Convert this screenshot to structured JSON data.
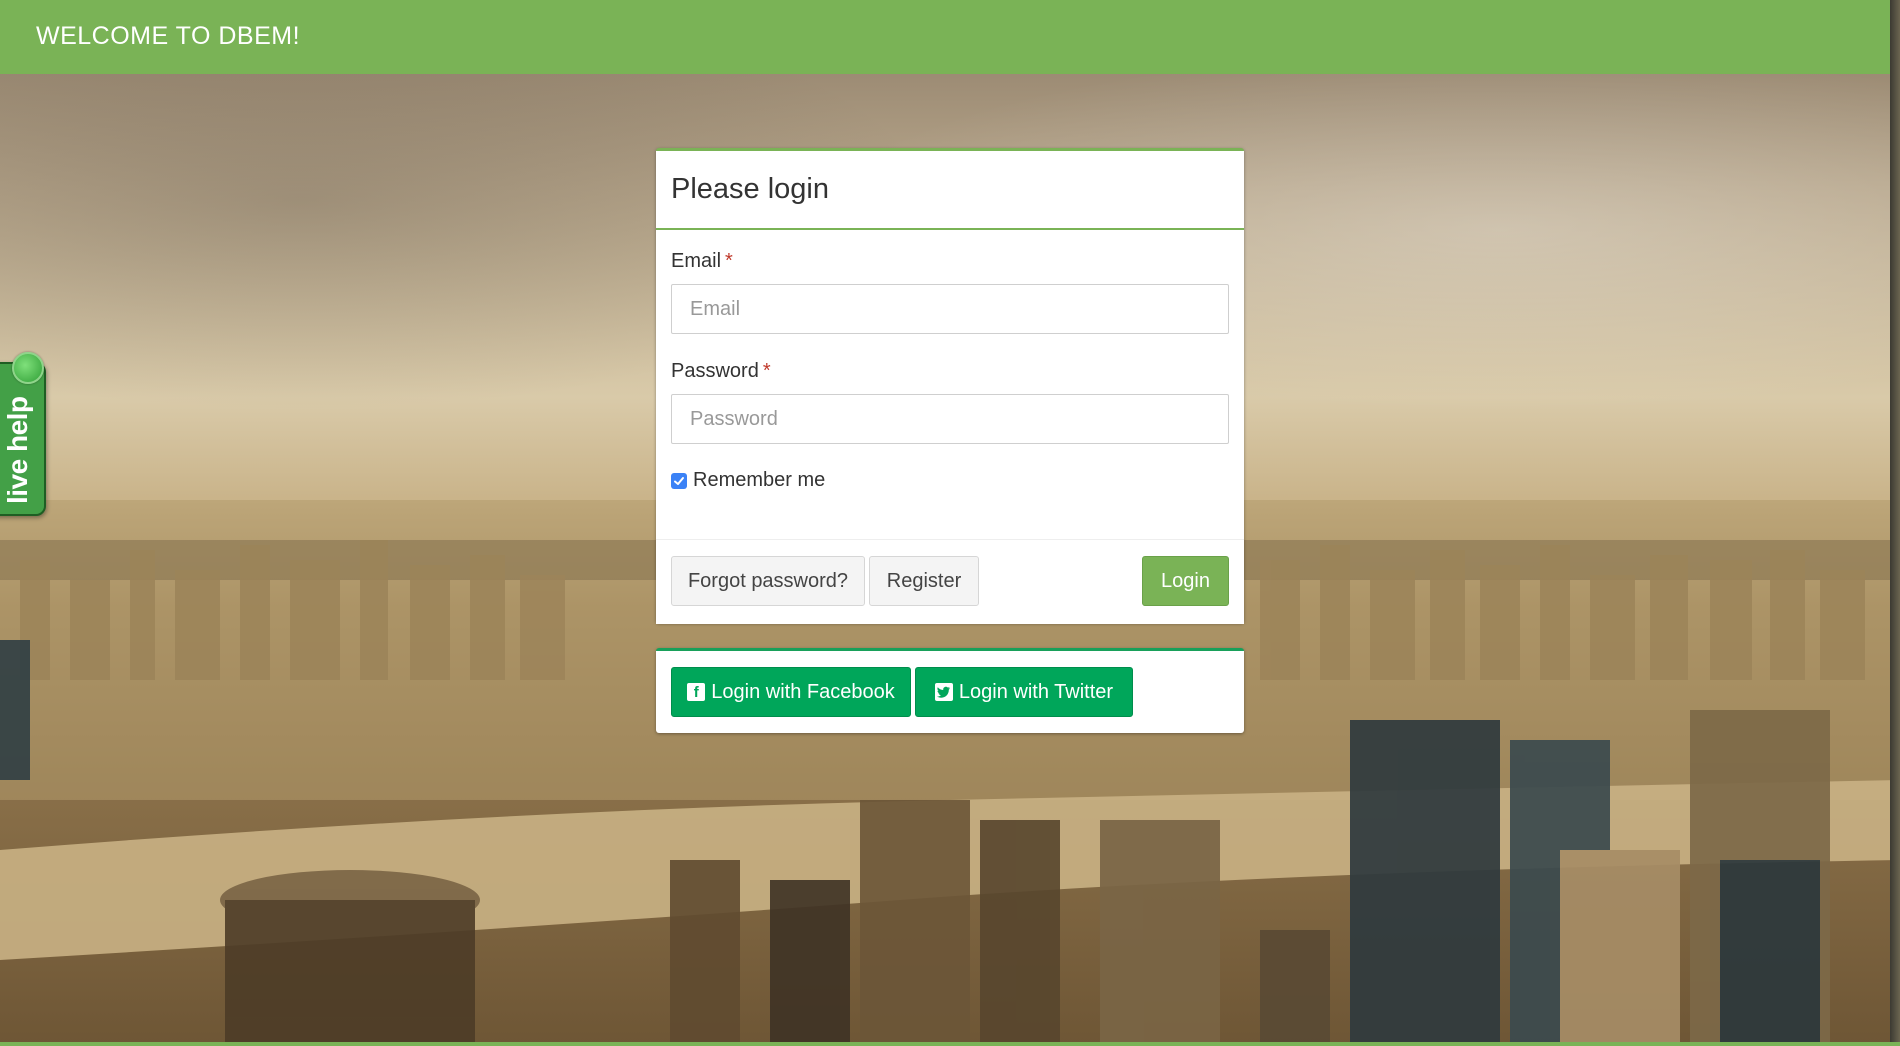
{
  "header": {
    "title": "WELCOME TO DBEM!"
  },
  "live_help": {
    "label": "live help"
  },
  "login_panel": {
    "title": "Please login",
    "email": {
      "label": "Email",
      "required_mark": "*",
      "value": "",
      "placeholder": "Email"
    },
    "password": {
      "label": "Password",
      "required_mark": "*",
      "value": "",
      "placeholder": "Password"
    },
    "remember": {
      "label": "Remember me",
      "checked": true
    },
    "buttons": {
      "forgot": "Forgot password?",
      "register": "Register",
      "login": "Login"
    }
  },
  "social": {
    "facebook": {
      "label": "Login with Facebook",
      "icon": "facebook-icon"
    },
    "twitter": {
      "label": "Login with Twitter",
      "icon": "twitter-icon"
    }
  },
  "colors": {
    "brand_green": "#7ab356",
    "social_green": "#00a65a",
    "checkbox_blue": "#3b82f6",
    "required_red": "#c0392b"
  }
}
